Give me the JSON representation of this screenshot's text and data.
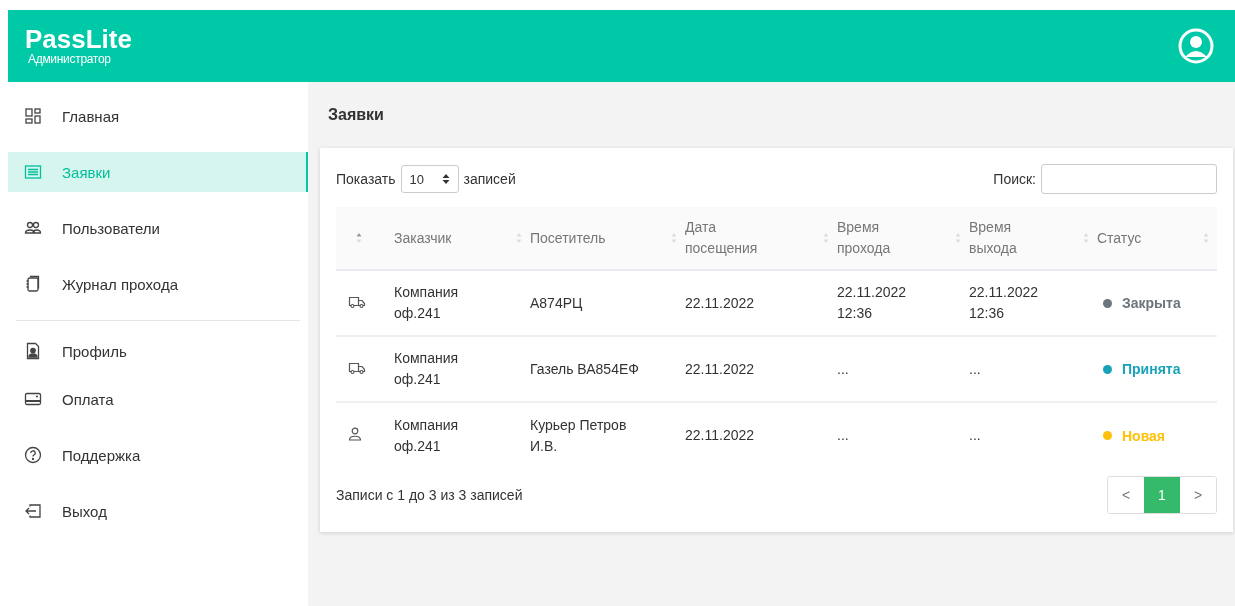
{
  "brand": {
    "title": "PassLite",
    "subtitle": "Администратор"
  },
  "sidebar": {
    "groups": [
      [
        {
          "label": "Главная",
          "selected": false
        },
        {
          "label": "Заявки",
          "selected": true
        },
        {
          "label": "Пользователи",
          "selected": false
        },
        {
          "label": "Журнал прохода",
          "selected": false
        }
      ],
      [
        {
          "label": "Профиль",
          "selected": false
        },
        {
          "label": "Оплата",
          "selected": false
        },
        {
          "label": "Поддержка",
          "selected": false
        },
        {
          "label": "Выход",
          "selected": false
        }
      ]
    ]
  },
  "page_title": "Заявки",
  "length": {
    "before": "Показать",
    "value": "10",
    "after": "записей"
  },
  "search": {
    "label": "Поиск:"
  },
  "table": {
    "columns": [
      {
        "sorted": true
      },
      {
        "label": "Заказчик",
        "sorted": false
      },
      {
        "label": "Посетитель",
        "sorted": false
      },
      {
        "label": "Дата посещения",
        "sorted": false
      },
      {
        "label": "Время прохода",
        "sorted": false
      },
      {
        "label": "Время выхода",
        "sorted": false
      },
      {
        "label": "Статус",
        "sorted": false
      }
    ],
    "rows": [
      {
        "kind": "truck",
        "customer": "Компания оф.241",
        "visitor": "А874РЦ",
        "date": "22.11.2022",
        "entry": "22.11.2022 12:36",
        "exit": "22.11.2022 12:36",
        "status": "Закрыта",
        "color": "#6c757d"
      },
      {
        "kind": "truck",
        "customer": "Компания оф.241",
        "visitor": "Газель ВА854ЕФ",
        "date": "22.11.2022",
        "entry": "...",
        "exit": "...",
        "status": "Принята",
        "color": "#17a2b8"
      },
      {
        "kind": "person",
        "customer": "Компания оф.241",
        "visitor": "Курьер Петров И.В.",
        "date": "22.11.2022",
        "entry": "...",
        "exit": "...",
        "status": "Новая",
        "color": "#ffc107"
      }
    ]
  },
  "info": "Записи с 1 до 3 из 3 записей",
  "pagination": {
    "prev": "<",
    "pages": [
      {
        "label": "1",
        "selected": true
      }
    ],
    "next": ">"
  }
}
